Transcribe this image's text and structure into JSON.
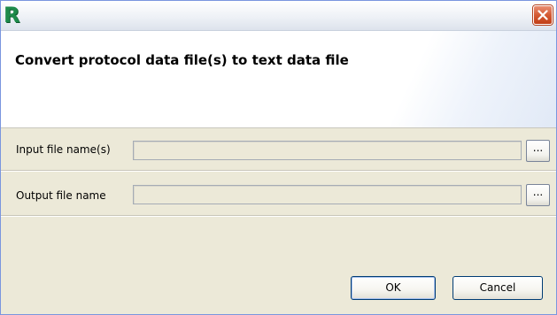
{
  "window": {
    "logo_text": "R",
    "close_icon": "close-icon",
    "accent_color": "#1e8a4a"
  },
  "header": {
    "title": "Convert protocol data file(s) to text data file"
  },
  "form": {
    "input": {
      "label": "Input file name(s)",
      "value": "",
      "browse_label": "..."
    },
    "output": {
      "label": "Output file name",
      "value": "",
      "browse_label": "..."
    }
  },
  "buttons": {
    "ok": "OK",
    "cancel": "Cancel"
  }
}
